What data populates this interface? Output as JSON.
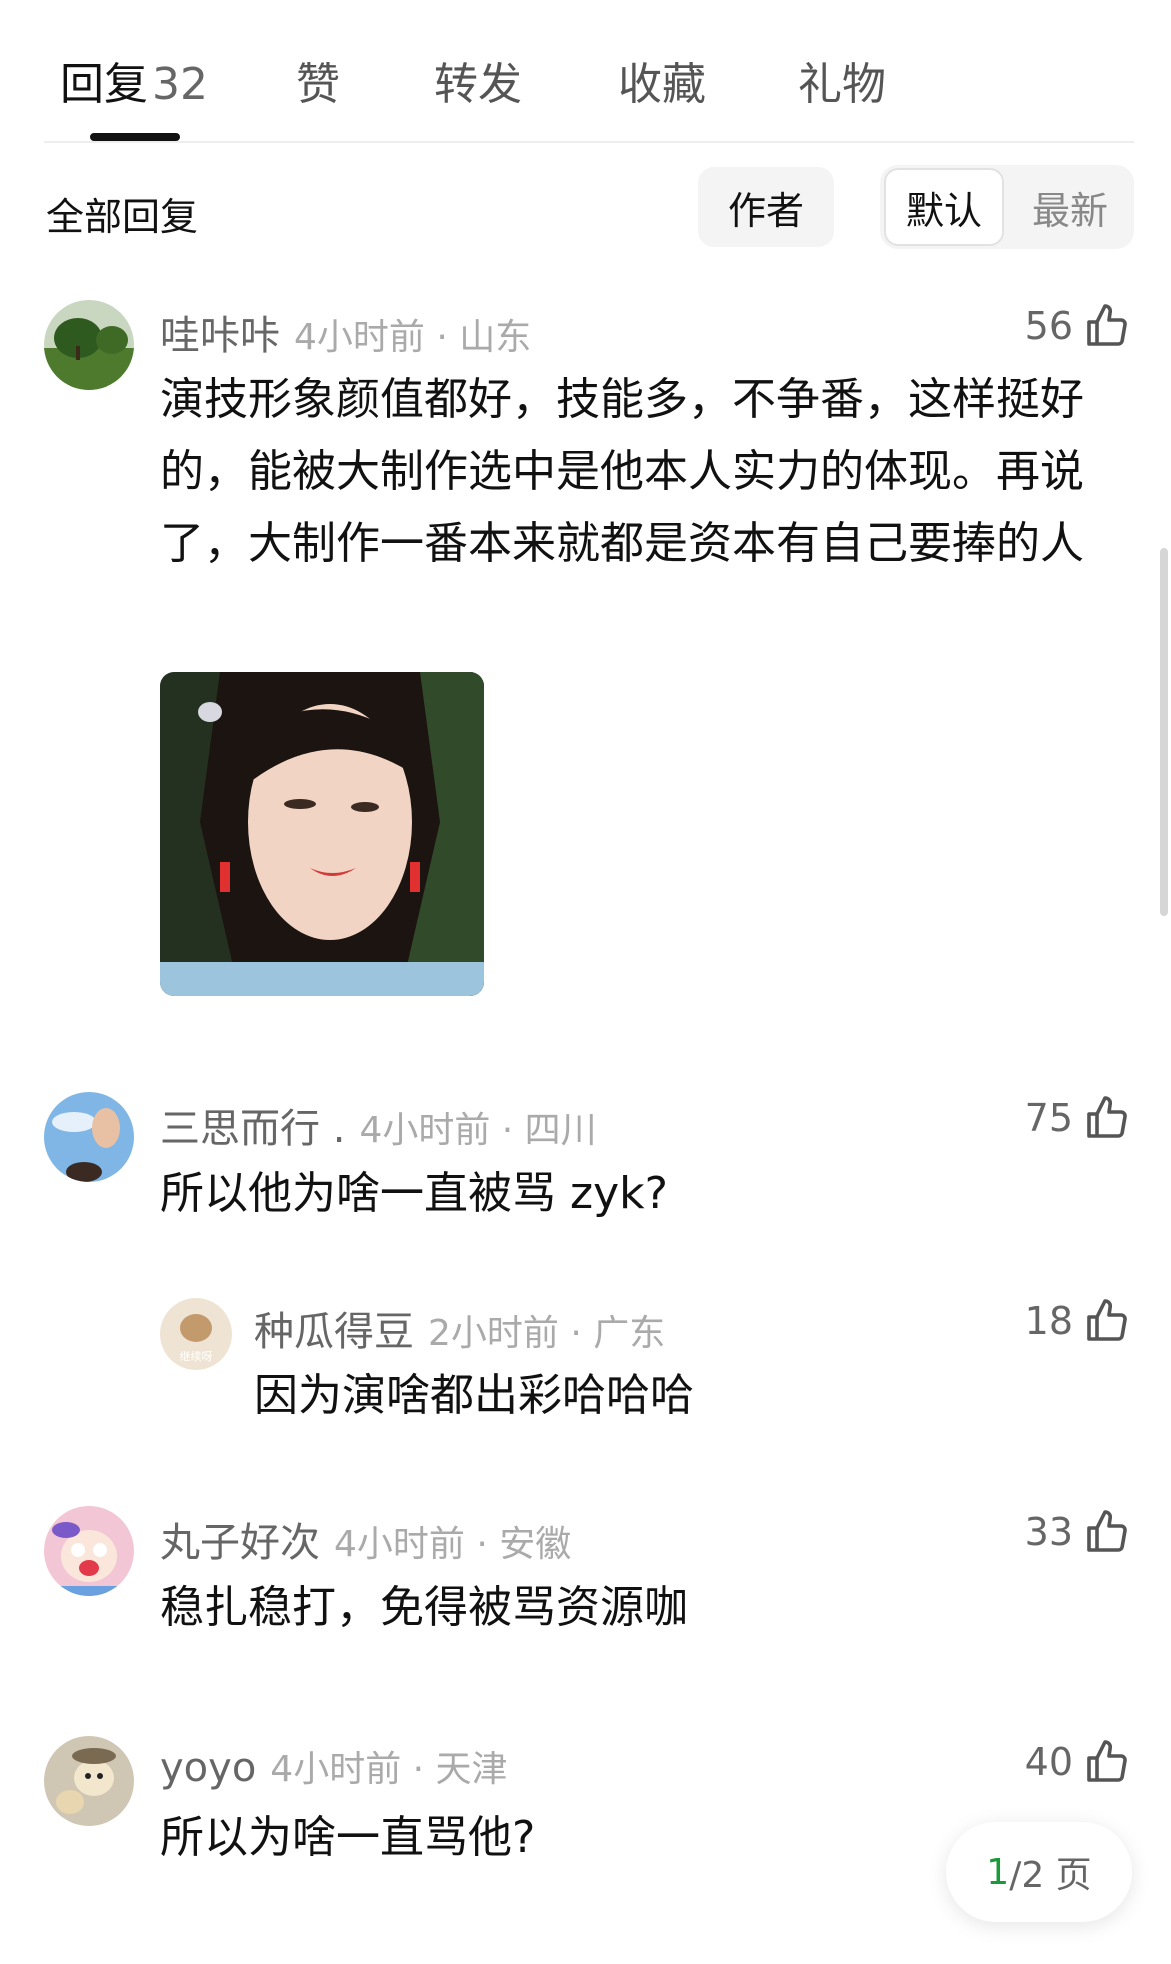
{
  "tabs": [
    {
      "label": "回复",
      "count": "32"
    },
    {
      "label": "赞"
    },
    {
      "label": "转发"
    },
    {
      "label": "收藏"
    },
    {
      "label": "礼物"
    }
  ],
  "filter": {
    "label": "全部回复",
    "author_button": "作者",
    "sort_default": "默认",
    "sort_latest": "最新"
  },
  "comments": [
    {
      "username": "哇咔咔",
      "time_location": "4小时前 · 山东",
      "likes": "56",
      "text": "演技形象颜值都好，技能多，不争番，这样挺好的，能被大制作选中是他本人实力的体现。再说了，大制作一番本来就都是资本有自己要捧的人"
    },
    {
      "username": "三思而行 .",
      "time_location": "4小时前 · 四川",
      "likes": "75",
      "text": "所以他为啥一直被骂 zyk?"
    },
    {
      "username": "种瓜得豆",
      "time_location": "2小时前 · 广东",
      "likes": "18",
      "text": "因为演啥都出彩哈哈哈",
      "avatar_label": "继续呀"
    },
    {
      "username": "丸子好次",
      "time_location": "4小时前 · 安徽",
      "likes": "33",
      "text": "稳扎稳打，免得被骂资源咖"
    },
    {
      "username": "yoyo",
      "time_location": "4小时前 · 天津",
      "likes": "40",
      "text": "所以为啥一直骂他?"
    }
  ],
  "pagination": {
    "current": "1",
    "total": "/2 页"
  },
  "colors": {
    "accent_green": "#1a9a3a",
    "meta_gray": "#aaaaaa"
  },
  "icons": [
    "thumbs-up-icon"
  ]
}
